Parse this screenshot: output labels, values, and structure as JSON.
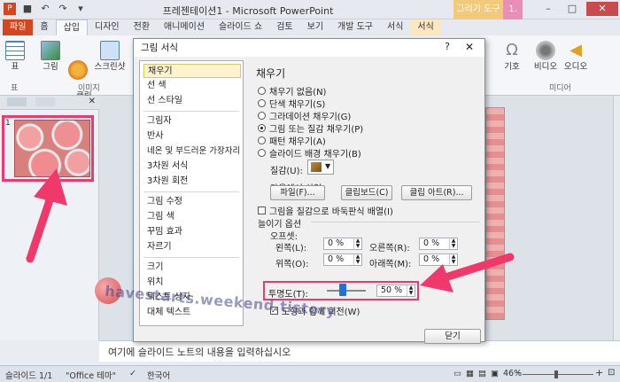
{
  "window": {
    "title": "프레젠테이션1 - Microsoft PowerPoint",
    "context_tab_group": "그리기 도구",
    "context_tab_group2": "1."
  },
  "tabs": [
    "파일",
    "홈",
    "삽입",
    "디자인",
    "전환",
    "애니메이션",
    "슬라이드 쇼",
    "검토",
    "보기",
    "개발 도구",
    "서식",
    "서식"
  ],
  "ribbon": {
    "buttons": [
      "표",
      "그림",
      "클립\n아트",
      "스크린샷",
      "기호",
      "비디오",
      "오디오"
    ],
    "groups": [
      "표",
      "이미지",
      "미디어"
    ]
  },
  "dialog": {
    "title": "그림 서식",
    "help": "?",
    "close": "✕",
    "categories": [
      "채우기",
      "선 색",
      "선 스타일",
      "그림자",
      "반사",
      "네온 및 부드러운 가장자리",
      "3차원 서식",
      "3차원 회전",
      "그림 수정",
      "그림 색",
      "꾸밈 효과",
      "자르기",
      "크기",
      "위치",
      "텍스트 상자",
      "대체 텍스트"
    ],
    "pane_title": "채우기",
    "fill_options": [
      "채우기 없음(N)",
      "단색 채우기(S)",
      "그라데이션 채우기(G)",
      "그림 또는 질감 채우기(P)",
      "패턴 채우기(A)",
      "슬라이드 배경 채우기(B)"
    ],
    "selected_fill": 3,
    "texture_label": "질감(U):",
    "insert_from_label": "다음에서 삽입:",
    "file_button": "파일(F)...",
    "clipboard_button": "클립보드(C)",
    "clipart_button": "클립 아트(R)...",
    "tile_checkbox": "그림을 질감으로 바둑판식 배열(I)",
    "stretch_options_label": "늘이기 옵션",
    "offsets_label": "오프셋:",
    "left_label": "왼쪽(L):",
    "left_value": "0 %",
    "right_label": "오른쪽(R):",
    "right_value": "0 %",
    "top_label": "위쪽(O):",
    "top_value": "0 %",
    "bottom_label": "아래쪽(M):",
    "bottom_value": "0 %",
    "transparency_label": "투명도(T):",
    "transparency_value": "50 %",
    "transparency_fraction": 0.5,
    "rotate_checkbox": "도형과 함께 회전(W)",
    "close_button": "닫기"
  },
  "slide_panel": {
    "slide_number": "1"
  },
  "notes_placeholder": "여기에 슬라이드 노트의 내용을 입력하십시오",
  "statusbar": {
    "slide_info": "슬라이드 1/1",
    "theme": "\"Office 테마\"",
    "language": "한국어",
    "zoom": "46%"
  },
  "watermark": "havestarts.weekend.tistory"
}
